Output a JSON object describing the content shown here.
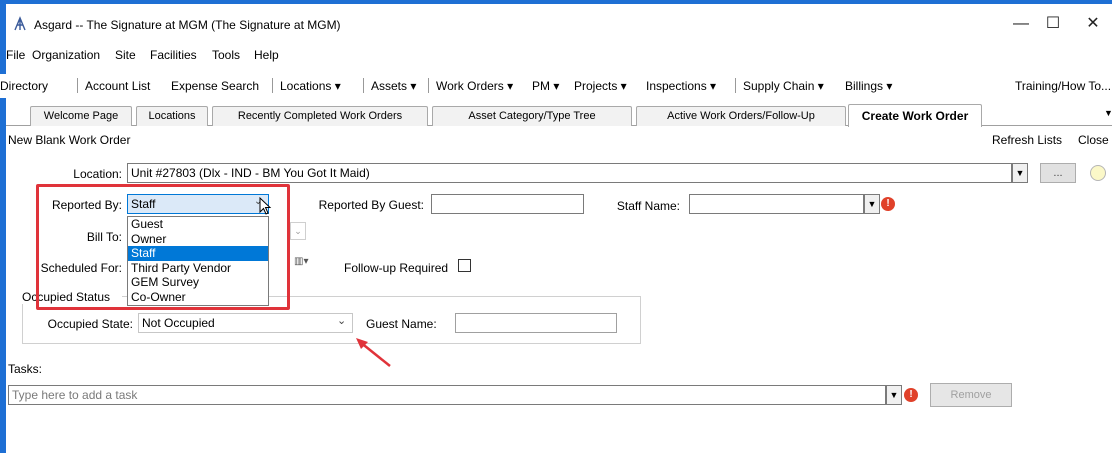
{
  "window": {
    "title": "Asgard -- The Signature at MGM (The Signature at MGM)",
    "minimize": "—",
    "maximize": "☐",
    "close": "✕"
  },
  "menu": [
    "File",
    "Organization",
    "Site",
    "Facilities",
    "Tools",
    "Help"
  ],
  "linkbar": {
    "items": [
      "Directory",
      "Account List",
      "Expense Search",
      "Locations ▾",
      "Assets ▾",
      "Work Orders ▾",
      "PM ▾",
      "Projects ▾",
      "Inspections ▾",
      "Supply Chain ▾",
      "Billings ▾"
    ],
    "right": "Training/How To..."
  },
  "tabs": [
    "Welcome Page",
    "Locations",
    "Recently Completed Work Orders",
    "Asset Category/Type Tree",
    "Active Work Orders/Follow-Up",
    "Create Work Order"
  ],
  "header": {
    "new_blank": "New Blank Work Order",
    "refresh": "Refresh Lists",
    "close": "Close"
  },
  "form": {
    "location_label": "Location:",
    "location_value": "Unit #27803 (Dlx - IND - BM You Got It Maid)",
    "browse_btn": "...",
    "reported_by_label": "Reported By:",
    "reported_by_value": "Staff",
    "reported_by_options": [
      "Guest",
      "Owner",
      "Staff",
      "Third Party Vendor",
      "GEM Survey",
      "Co-Owner"
    ],
    "reported_by_selected": "Staff",
    "reported_by_guest_label": "Reported By Guest:",
    "reported_by_guest_value": "",
    "staff_name_label": "Staff Name:",
    "staff_name_value": "",
    "bill_to_label": "Bill To:",
    "scheduled_for_label": "Scheduled For:",
    "follow_up_label": "Follow-up Required",
    "follow_up_checked": false,
    "occupied_status_group": "Occupied Status",
    "occupied_state_label": "Occupied State:",
    "occupied_state_value": "Not Occupied",
    "guest_name_label": "Guest Name:",
    "guest_name_value": "",
    "tasks_label": "Tasks:",
    "tasks_placeholder": "Type here to add a task",
    "remove_btn": "Remove"
  },
  "colors": {
    "frame": "#1e6fd4",
    "highlight_box": "#e0333a",
    "annotation_arrow": "#e0333a",
    "selected_option": "#0078d7",
    "error_icon": "#e0412a"
  }
}
